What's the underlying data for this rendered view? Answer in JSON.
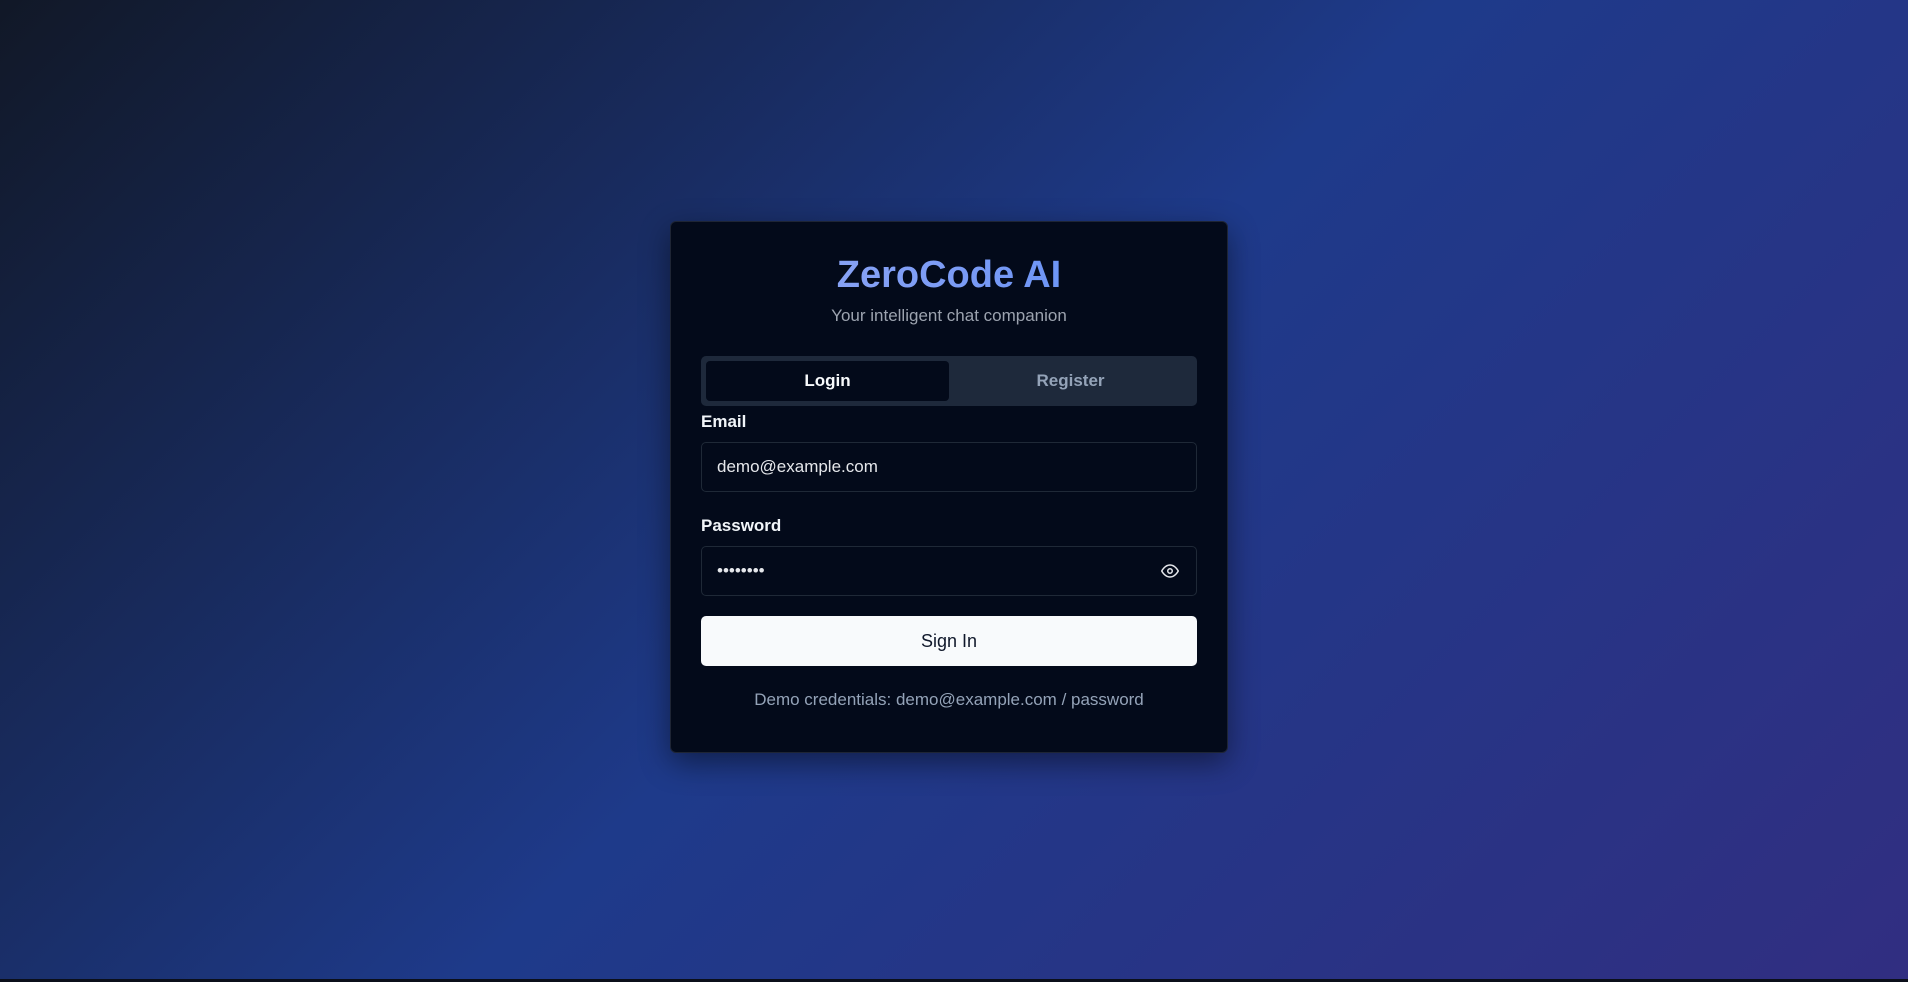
{
  "brand": {
    "title": "ZeroCode AI",
    "subtitle": "Your intelligent chat companion"
  },
  "tabs": [
    {
      "label": "Login",
      "active": true
    },
    {
      "label": "Register",
      "active": false
    }
  ],
  "form": {
    "email_label": "Email",
    "email_value": "demo@example.com",
    "password_label": "Password",
    "password_value": "password",
    "password_toggle_icon": "eye-icon",
    "submit_label": "Sign In"
  },
  "demo_note": "Demo credentials: demo@example.com / password",
  "colors": {
    "title_gradient_start": "#93a8f4",
    "title_gradient_end": "#5b8df6",
    "card_background": "#030a1a",
    "button_background": "#f8fafc"
  }
}
